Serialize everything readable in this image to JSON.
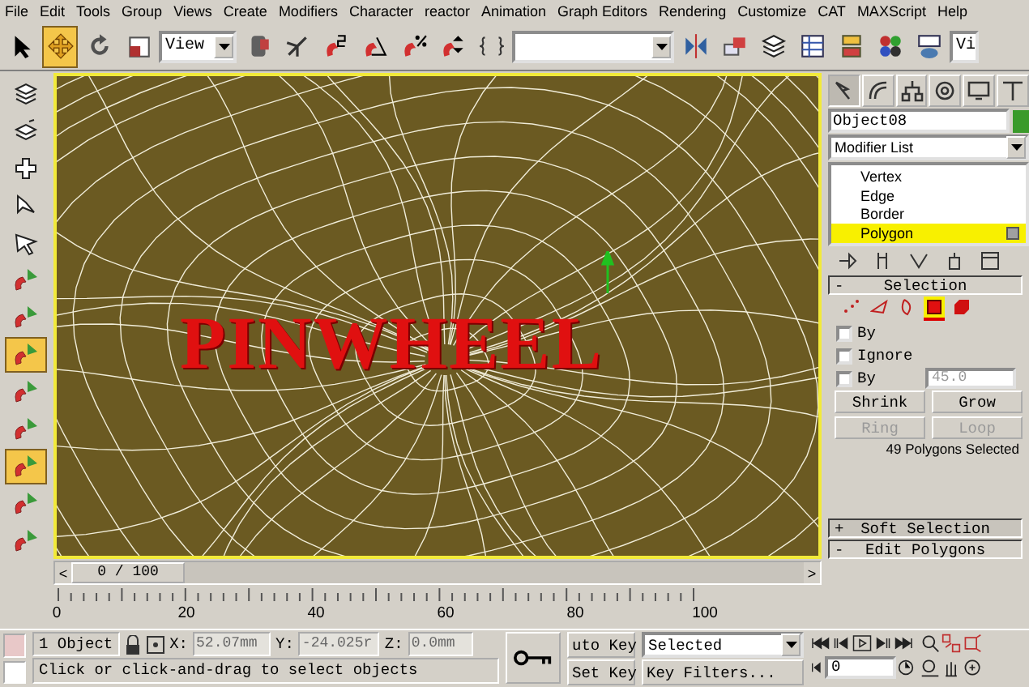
{
  "menu": [
    "File",
    "Edit",
    "Tools",
    "Group",
    "Views",
    "Create",
    "Modifiers",
    "Character",
    "reactor",
    "Animation",
    "Graph Editors",
    "Rendering",
    "Customize",
    "CAT",
    "MAXScript",
    "Help"
  ],
  "toolbar": [
    {
      "kind": "tool",
      "selected": false
    },
    {
      "kind": "tool",
      "selected": true
    },
    {
      "kind": "tool",
      "selected": false
    },
    {
      "kind": "tool",
      "selected": false
    },
    {
      "kind": "dropdown",
      "value": "View"
    },
    {
      "kind": "tool",
      "selected": false
    },
    {
      "kind": "tool",
      "selected": false
    },
    {
      "kind": "tool",
      "selected": false
    },
    {
      "kind": "tool",
      "selected": false
    },
    {
      "kind": "tool",
      "selected": false
    },
    {
      "kind": "tool",
      "selected": false
    },
    {
      "kind": "tool",
      "selected": false
    },
    {
      "kind": "dropdown"
    },
    {
      "kind": "tool",
      "selected": false
    },
    {
      "kind": "tool",
      "selected": false
    },
    {
      "kind": "tool",
      "selected": false
    },
    {
      "kind": "tool",
      "selected": false
    },
    {
      "kind": "tool",
      "selected": false
    },
    {
      "kind": "tool",
      "selected": false
    },
    {
      "kind": "tool",
      "selected": false
    },
    {
      "kind": "dropdown",
      "value": "Vi"
    }
  ],
  "left_toolbar": [
    {
      "selected": false
    },
    {
      "selected": false
    },
    {
      "selected": false
    },
    {
      "selected": false
    },
    {
      "selected": false
    },
    {
      "selected": false
    },
    {
      "selected": false
    },
    {
      "selected": true
    },
    {
      "selected": false
    },
    {
      "selected": false
    },
    {
      "selected": true
    },
    {
      "selected": false
    },
    {
      "selected": false
    }
  ],
  "viewport": {
    "overlay_text": "PINWHEEL"
  },
  "command_panel": {
    "tabs": [
      {
        "selected": true
      },
      {
        "selected": false
      },
      {
        "selected": false
      },
      {
        "selected": false
      },
      {
        "selected": false
      },
      {
        "selected": false
      }
    ],
    "object_name": "Object08",
    "modifier_list": "Modifier List",
    "stack": [
      {
        "label": "Vertex",
        "selected": false
      },
      {
        "label": "Edge",
        "selected": false
      },
      {
        "label": "Border",
        "selected": false
      },
      {
        "label": "Polygon",
        "selected": true
      }
    ],
    "rollouts": [
      {
        "sign": "-",
        "title": "Selection",
        "expanded": true
      },
      {
        "sign": "+",
        "title": "Soft Selection",
        "expanded": false
      },
      {
        "sign": "-",
        "title": "Edit Polygons",
        "expanded": true
      }
    ],
    "subobjects": [
      {
        "selected": false
      },
      {
        "selected": false
      },
      {
        "selected": false
      },
      {
        "selected": true
      },
      {
        "selected": false
      }
    ],
    "checkboxes": [
      {
        "label": "By",
        "checked": false
      },
      {
        "label": "Ignore",
        "checked": false
      },
      {
        "label": "By",
        "checked": false,
        "value": "45.0",
        "value_disabled": true
      }
    ],
    "buttons": [
      {
        "label": "Shrink",
        "disabled": false
      },
      {
        "label": "Grow",
        "disabled": false
      },
      {
        "label": "Ring",
        "disabled": true
      },
      {
        "label": "Loop",
        "disabled": true
      }
    ],
    "selection_status": "49 Polygons Selected"
  },
  "time_slider": {
    "prev": "<",
    "position": "0 / 100",
    "next": ">",
    "level": 0
  },
  "track": {
    "labels": [
      "0",
      "20",
      "40",
      "60",
      "80",
      "100"
    ]
  },
  "status_bar": {
    "selection": "1 Object",
    "x_label": "X:",
    "x": "52.07mm",
    "y_label": "Y:",
    "y": "-24.025r",
    "z_label": "Z:",
    "z": "0.0mm",
    "prompt": "Click or click-and-drag to select objects",
    "auto_key": "uto Key",
    "set_key": "Set Key",
    "key_mode": "Selected",
    "key_filters": "Key Filters...",
    "frame": "0"
  }
}
